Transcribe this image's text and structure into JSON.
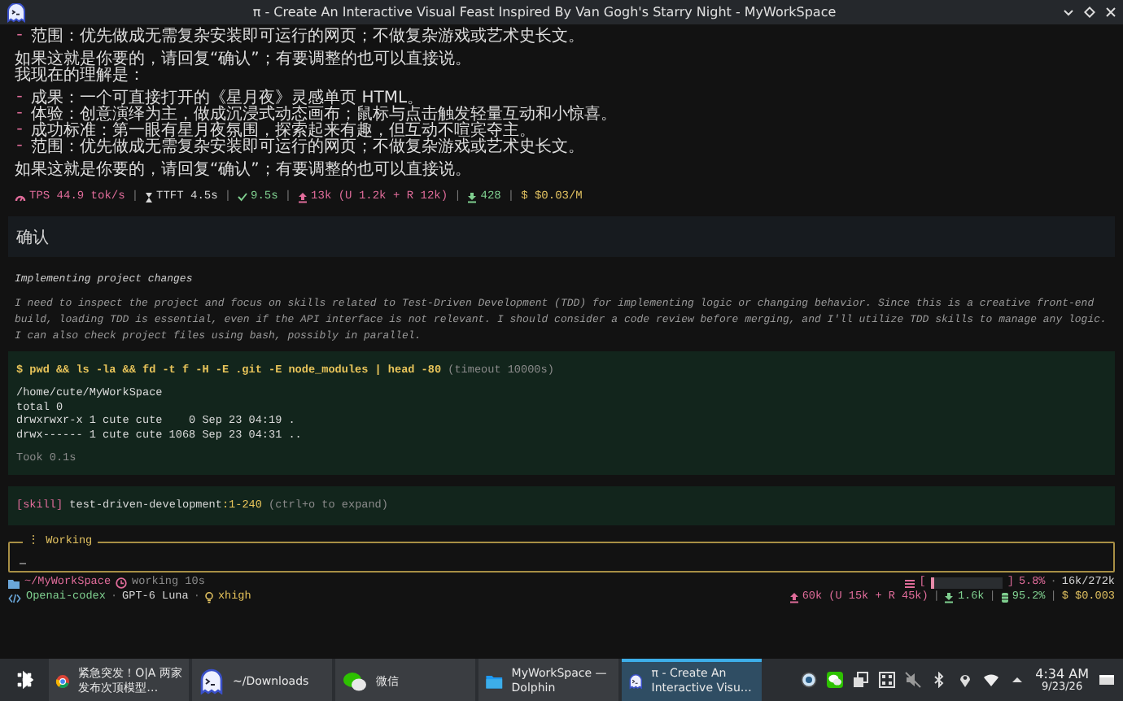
{
  "window": {
    "title": "π - Create An Interactive Visual Feast Inspired By Van Gogh's Starry Night - MyWorkSpace"
  },
  "assistant_message": {
    "blocks": [
      [
        {
          "marker": "-",
          "text": "范围：优先做成无需复杂安装即可运行的网页；不做复杂游戏或艺术史长文。"
        }
      ],
      [
        {
          "text": "如果这就是你要的，请回复“确认”；有要调整的也可以直接说。"
        },
        {
          "text": "我现在的理解是："
        }
      ],
      [
        {
          "marker": "-",
          "text": "成果：一个可直接打开的《星月夜》灵感单页 HTML。"
        },
        {
          "marker": "-",
          "text": "体验：创意演绎为主，做成沉浸式动态画布；鼠标与点击触发轻量互动和小惊喜。"
        },
        {
          "marker": "-",
          "text": "成功标准：第一眼有星月夜氛围，探索起来有趣，但互动不喧宾夺主。"
        },
        {
          "marker": "-",
          "text": "范围：优先做成无需复杂安装即可运行的网页；不做复杂游戏或艺术史长文。"
        }
      ],
      [
        {
          "text": "如果这就是你要的，请回复“确认”；有要调整的也可以直接说。"
        }
      ]
    ]
  },
  "stats": {
    "separator": "|",
    "items": [
      {
        "kind": "gauge",
        "text": "TPS 44.9 tok/s",
        "color": "#e06c9a"
      },
      {
        "kind": "hourglass",
        "text": "TTFT 4.5s",
        "color": "#d8d8d8"
      },
      {
        "kind": "check",
        "text": "9.5s",
        "color": "#7fcf8f"
      },
      {
        "kind": "upload",
        "text": "13k (U 1.2k + R 12k)",
        "color": "#e06c9a"
      },
      {
        "kind": "download",
        "text": "428",
        "color": "#7fcf8f"
      },
      {
        "kind": "dollar",
        "text": "$ $0.03/M",
        "color": "#e0c060"
      }
    ]
  },
  "user_message": {
    "text": "确认"
  },
  "thinking": {
    "heading": "Implementing project changes",
    "text": "I need to inspect the project and focus on skills related to Test-Driven Development (TDD) for implementing logic or changing behavior. Since this is a creative front-end build, loading TDD is essential, even if the API interface is not relevant. I should consider a code review before merging, and I'll utilize TDD skills to manage any logic. I can also check project files using bash, possibly in parallel."
  },
  "tool_call": {
    "command": "$ pwd && ls -la && fd -t f -H -E .git -E node_modules | head -80",
    "timeout": "(timeout 10000s)",
    "output": [
      "/home/cute/MyWorkSpace",
      "total 0",
      "drwxrwxr-x 1 cute cute    0 Sep 23 04:19 .",
      "drwx------ 1 cute cute 1068 Sep 23 04:31 .."
    ],
    "duration": "Took 0.1s"
  },
  "skill_call": {
    "tag": "[skill]",
    "name": "test-driven-development",
    "range": ":1-240",
    "hint": "(ctrl+o to expand)"
  },
  "editor": {
    "spinner": "⋮",
    "label": "Working"
  },
  "footer": {
    "path": "~/MyWorkSpace",
    "status": "working 10s",
    "separator": "·",
    "model": [
      "Openai-codex",
      "GPT-6 Luna"
    ],
    "effort": "xhigh",
    "context": {
      "open": "[",
      "close": "]",
      "level": 0.058,
      "percent": "5.8%",
      "tokens": "16k/272k"
    },
    "usage": {
      "separator": "|",
      "items": [
        {
          "kind": "upload",
          "text": "60k (U 15k + R 45k)",
          "color": "#e06c9a"
        },
        {
          "kind": "download",
          "text": "1.6k",
          "color": "#7fcf8f"
        },
        {
          "kind": "cache",
          "text": "95.2%",
          "color": "#7fcf8f"
        },
        {
          "kind": "dollar",
          "text": "$ $0.003",
          "color": "#e0c060"
        }
      ]
    }
  },
  "taskbar": {
    "tasks": [
      {
        "kind": "browser",
        "label": "紧急突发！O|A 两家发布次顶模型…",
        "selected": false
      },
      {
        "kind": "terminal",
        "label": "~/Downloads",
        "selected": false
      },
      {
        "kind": "chat",
        "label": "微信",
        "selected": false
      },
      {
        "kind": "folder",
        "label": "MyWorkSpace — Dolphin",
        "selected": false
      },
      {
        "kind": "terminal",
        "label": "π - Create An Interactive Visu…",
        "selected": true
      }
    ],
    "time": "4:34 AM",
    "date": "9/23/26"
  }
}
